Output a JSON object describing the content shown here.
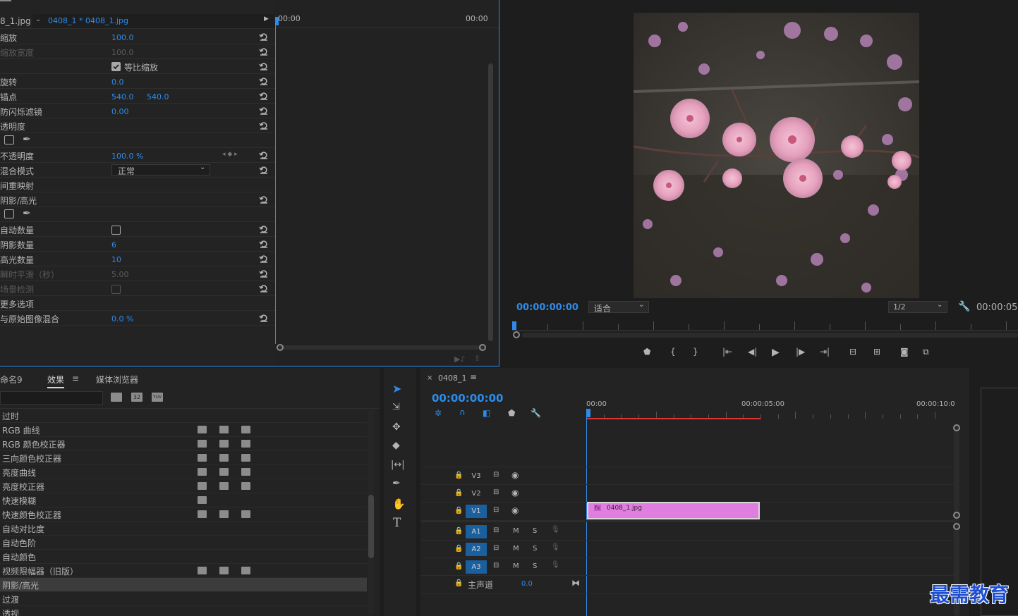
{
  "effect_controls": {
    "source_tab": "8_1.jpg",
    "clip_tab": "0408_1 * 0408_1.jpg",
    "time_start": "00:00",
    "time_end": "00:00",
    "rows": [
      {
        "label": "缩放",
        "value": "100.0",
        "dim": false
      },
      {
        "label": "缩放宽度",
        "value": "100.0",
        "dim": true
      },
      {
        "label": "",
        "checkbox_label": "等比缩放",
        "checked": true
      },
      {
        "label": "旋转",
        "value": "0.0",
        "dim": false
      },
      {
        "label": "锚点",
        "value": "540.0",
        "value2": "540.0",
        "dim": false
      },
      {
        "label": "防闪烁滤镜",
        "value": "0.00",
        "dim": false
      },
      {
        "label": "透明度",
        "value": "",
        "dim": false
      },
      {
        "label": "",
        "mask_tools": true
      },
      {
        "label": "不透明度",
        "value": "100.0 %",
        "dim": false
      },
      {
        "label": "混合模式",
        "select": "正常"
      },
      {
        "label": "间重映射",
        "value": "",
        "dim": false
      },
      {
        "label": "阴影/高光",
        "value": "",
        "dim": false
      },
      {
        "label": "",
        "mask_tools": true
      },
      {
        "label": "自动数量",
        "checkbox_only": true
      },
      {
        "label": "阴影数量",
        "value": "6",
        "dim": false
      },
      {
        "label": "高光数量",
        "value": "10",
        "dim": false
      },
      {
        "label": "瞬时平滑（秒）",
        "value": "5.00",
        "dim": true
      },
      {
        "label": "场景检测",
        "checkbox_only": true,
        "dim": true
      },
      {
        "label": "更多选项",
        "value": "",
        "dim": false
      },
      {
        "label": "与原始图像混合",
        "value": "0.0 %",
        "dim": false
      }
    ]
  },
  "program": {
    "timecode": "00:00:00:00",
    "fit_label": "适合",
    "resolution": "1/2",
    "duration": "00:00:05",
    "colors": {
      "accent": "#2d8ceb",
      "petal": "#e8a4c0"
    }
  },
  "effects_panel": {
    "tab_names": "命名9",
    "tab_effects": "效果",
    "tab_media": "媒体浏览器",
    "badges": [
      "加速",
      "32",
      "YUV"
    ],
    "items": [
      {
        "name": "过时",
        "badges": 0
      },
      {
        "name": "RGB 曲线",
        "badges": 3
      },
      {
        "name": "RGB 颜色校正器",
        "badges": 3
      },
      {
        "name": "三向颜色校正器",
        "badges": 3
      },
      {
        "name": "亮度曲线",
        "badges": 3
      },
      {
        "name": "亮度校正器",
        "badges": 3
      },
      {
        "name": "快速模糊",
        "badges": 1
      },
      {
        "name": "快速颜色校正器",
        "badges": 3
      },
      {
        "name": "自动对比度",
        "badges": 0
      },
      {
        "name": "自动色阶",
        "badges": 0
      },
      {
        "name": "自动颜色",
        "badges": 0
      },
      {
        "name": "视频限幅器（旧版）",
        "badges": 3
      },
      {
        "name": "阴影/高光",
        "badges": 0,
        "selected": true
      },
      {
        "name": "过渡",
        "badges": 0
      },
      {
        "name": "透视",
        "badges": 0
      }
    ]
  },
  "timeline": {
    "sequence_name": "0408_1",
    "timecode": "00:00:00:00",
    "ruler": [
      "00:00",
      "00:00:05:00",
      "00:00:10:0"
    ],
    "video_tracks": [
      "V3",
      "V2",
      "V1"
    ],
    "audio_tracks": [
      "A1",
      "A2",
      "A3"
    ],
    "mute": "M",
    "solo": "S",
    "master_label": "主声道",
    "master_value": "0.0",
    "clip_name": "0408_1.jpg",
    "clip_fx": "fx",
    "clip_color": "#e07ee0"
  },
  "watermark": "最需教育"
}
